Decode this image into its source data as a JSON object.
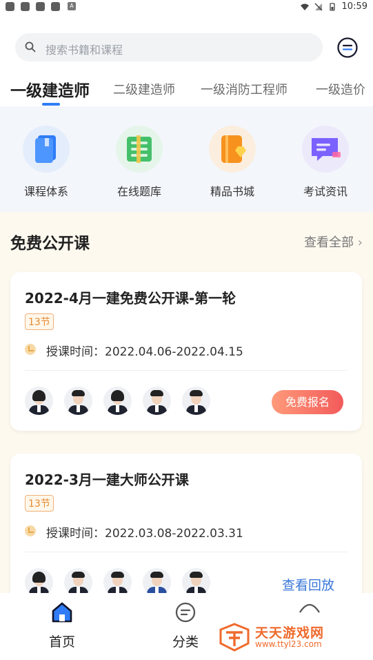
{
  "status_bar": {
    "time": "10:59",
    "notif_letter": "A"
  },
  "search": {
    "placeholder": "搜索书籍和课程"
  },
  "tabs": [
    {
      "label": "一级建造师"
    },
    {
      "label": "二级建造师"
    },
    {
      "label": "一级消防工程师"
    },
    {
      "label": "一级造价"
    }
  ],
  "quick_entries": [
    {
      "label": "课程体系",
      "icon": "book-icon",
      "color": "#2f7cf6"
    },
    {
      "label": "在线题库",
      "icon": "question-bank-icon",
      "color": "#45c06a"
    },
    {
      "label": "精品书城",
      "icon": "bookstore-icon",
      "color": "#f7921e"
    },
    {
      "label": "考试资讯",
      "icon": "news-icon",
      "color": "#7b61ff"
    }
  ],
  "section": {
    "title": "免费公开课",
    "more": "查看全部"
  },
  "courses": [
    {
      "title": "2022-4月一建免费公开课-第一轮",
      "badge": "13节",
      "time_label": "授课时间：2022.04.06-2022.04.15",
      "action": "免费报名"
    },
    {
      "title": "2022-3月一建大师公开课",
      "badge": "13节",
      "time_label": "授课时间：2022.03.08-2022.03.31",
      "action": "查看回放"
    }
  ],
  "tabbar": [
    {
      "label": "首页",
      "icon": "home-icon"
    },
    {
      "label": "分类",
      "icon": "category-icon"
    }
  ],
  "watermark": {
    "name": "天天游戏网",
    "url": "www.ttyl23.com"
  },
  "colors": {
    "accent": "#2f7cf6",
    "cta": "#f25a5a",
    "link": "#3977d9"
  }
}
